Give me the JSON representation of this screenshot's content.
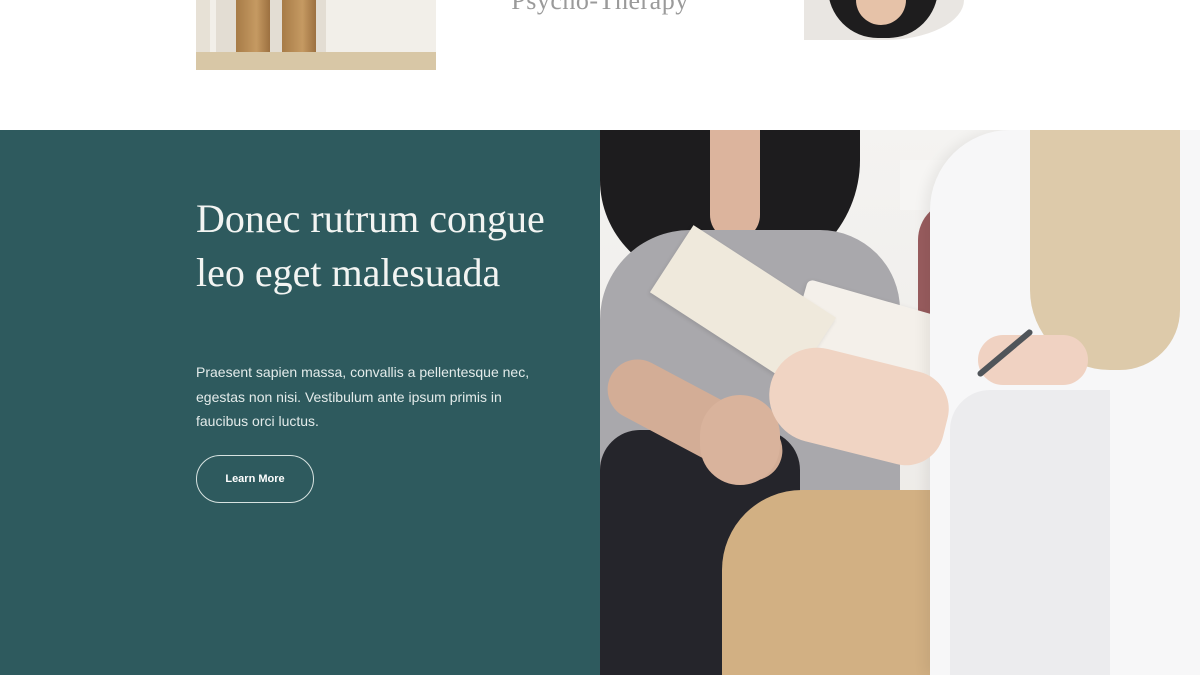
{
  "top_strip": {
    "service_caption": "Psycho-Therapy"
  },
  "feature": {
    "heading": "Donec rutrum congue leo eget malesuada",
    "body": "Praesent sapien massa, convallis a pellentesque nec, egestas non nisi. Vestibulum ante ipsum primis in faucibus orci luctus.",
    "cta_label": "Learn More"
  },
  "colors": {
    "panel_background": "#2e5a5e",
    "heading_text": "#f2f4f2",
    "body_text": "#e3ebea",
    "caption_text": "#9a9a9a",
    "page_background": "#ffffff"
  }
}
